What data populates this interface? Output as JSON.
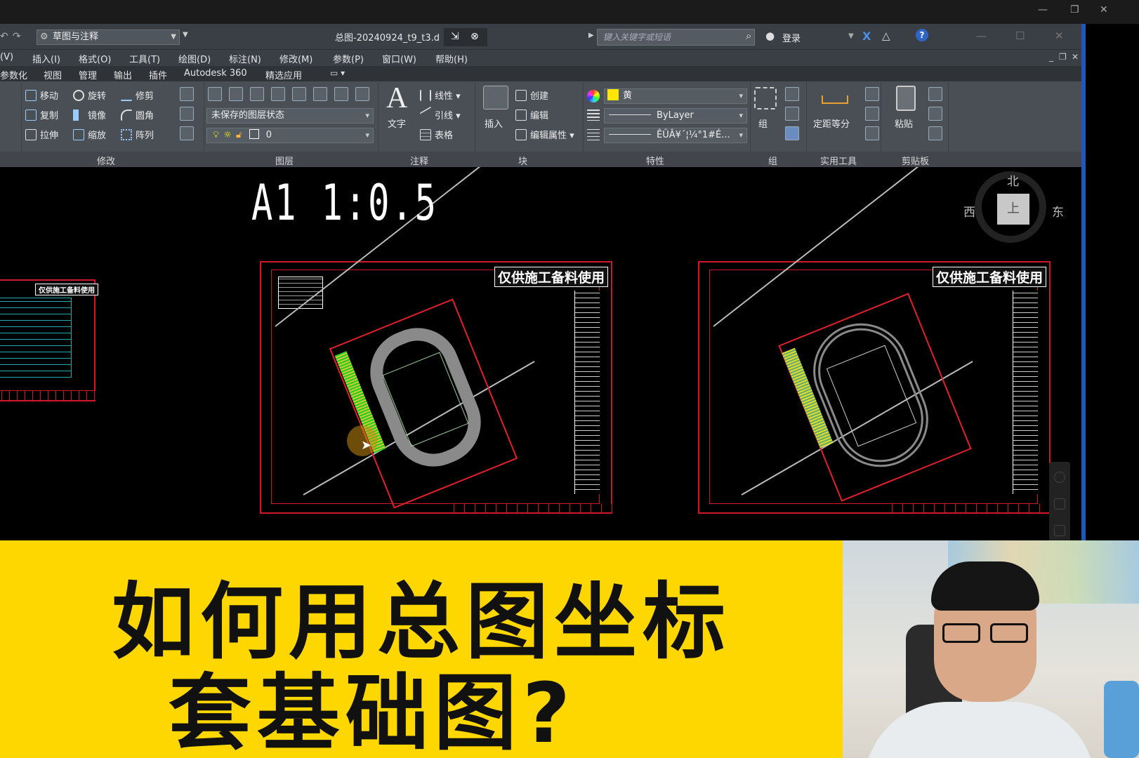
{
  "window": {
    "workspace": "草图与注释",
    "doc_title": "总图-20240924_t9_t3.d",
    "search_placeholder": "键入关键字或短语",
    "login": "登录"
  },
  "menu": [
    "(V)",
    "插入(I)",
    "格式(O)",
    "工具(T)",
    "绘图(D)",
    "标注(N)",
    "修改(M)",
    "参数(P)",
    "窗口(W)",
    "帮助(H)"
  ],
  "tabs": [
    "参数化",
    "视图",
    "管理",
    "输出",
    "插件",
    "Autodesk 360",
    "精选应用"
  ],
  "ribbon": {
    "modify": {
      "title": "修改",
      "tools": [
        "移动",
        "旋转",
        "修剪",
        "复制",
        "镜像",
        "圆角",
        "拉伸",
        "缩放",
        "阵列"
      ]
    },
    "layer": {
      "title": "图层",
      "state": "未保存的图层状态",
      "current": "0"
    },
    "annotation": {
      "title": "注释",
      "text": "文字",
      "linear": "线性",
      "leader": "引线",
      "table": "表格"
    },
    "block": {
      "title": "块",
      "insert": "插入",
      "create": "创建",
      "edit": "编辑",
      "edit_attr": "编辑属性"
    },
    "properties": {
      "title": "特性",
      "color": "黄",
      "linetype": "ByLayer",
      "lineweight": "ÊÛÂ¥´¦¼°1#É..."
    },
    "group": {
      "title": "组",
      "label": "组"
    },
    "utilities": {
      "title": "实用工具",
      "measure": "定距等分"
    },
    "clipboard": {
      "title": "剪贴板",
      "paste": "粘贴"
    }
  },
  "canvas": {
    "scale_label": "A1 1:0.5",
    "stamp": "仅供施工备料使用",
    "stamp_small": "仅供施工备料使用",
    "compass": {
      "north": "北",
      "west": "西",
      "east": "东",
      "top": "上"
    }
  },
  "banner": {
    "line1": "如何用总图坐标",
    "line2": "套基础图?"
  },
  "colors": {
    "accent": "#2456b8",
    "banner": "#fed700",
    "frame": "#d2162a",
    "layer_color": "#ffe600"
  }
}
